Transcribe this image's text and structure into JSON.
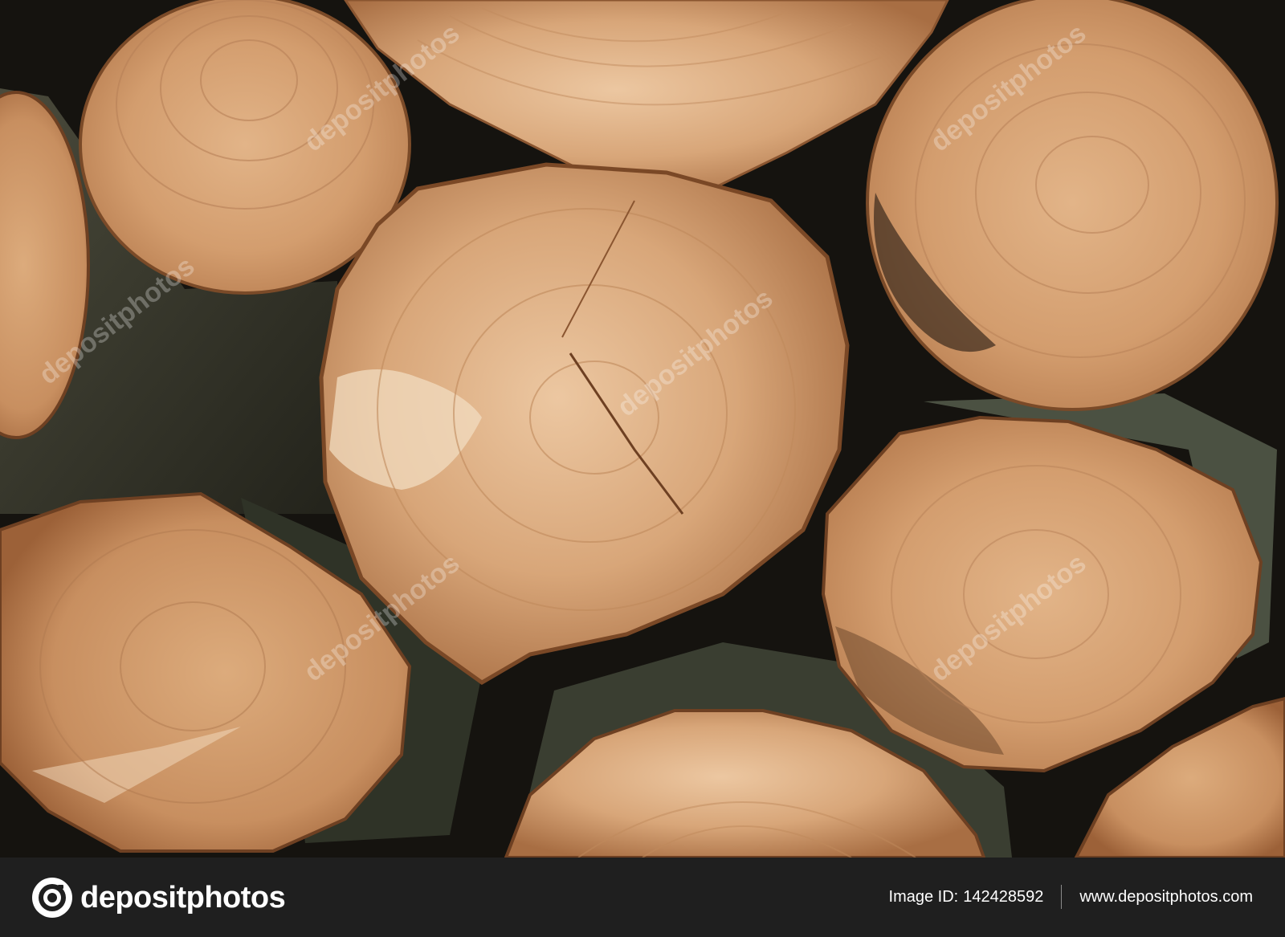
{
  "photo": {
    "subject": "stack of cut log ends",
    "watermark": "depositphotos"
  },
  "footer": {
    "brand": "depositphotos",
    "image_id_label": "Image ID:",
    "image_id": "142428592",
    "url": "www.depositphotos.com"
  },
  "colors": {
    "wood_light": "#d9a77a",
    "wood_mid": "#c48a5c",
    "bark": "#3b3b2e",
    "gap": "#15130f",
    "footer_bg": "#1f1f1f"
  },
  "icons": [
    "camera-logo-icon"
  ]
}
